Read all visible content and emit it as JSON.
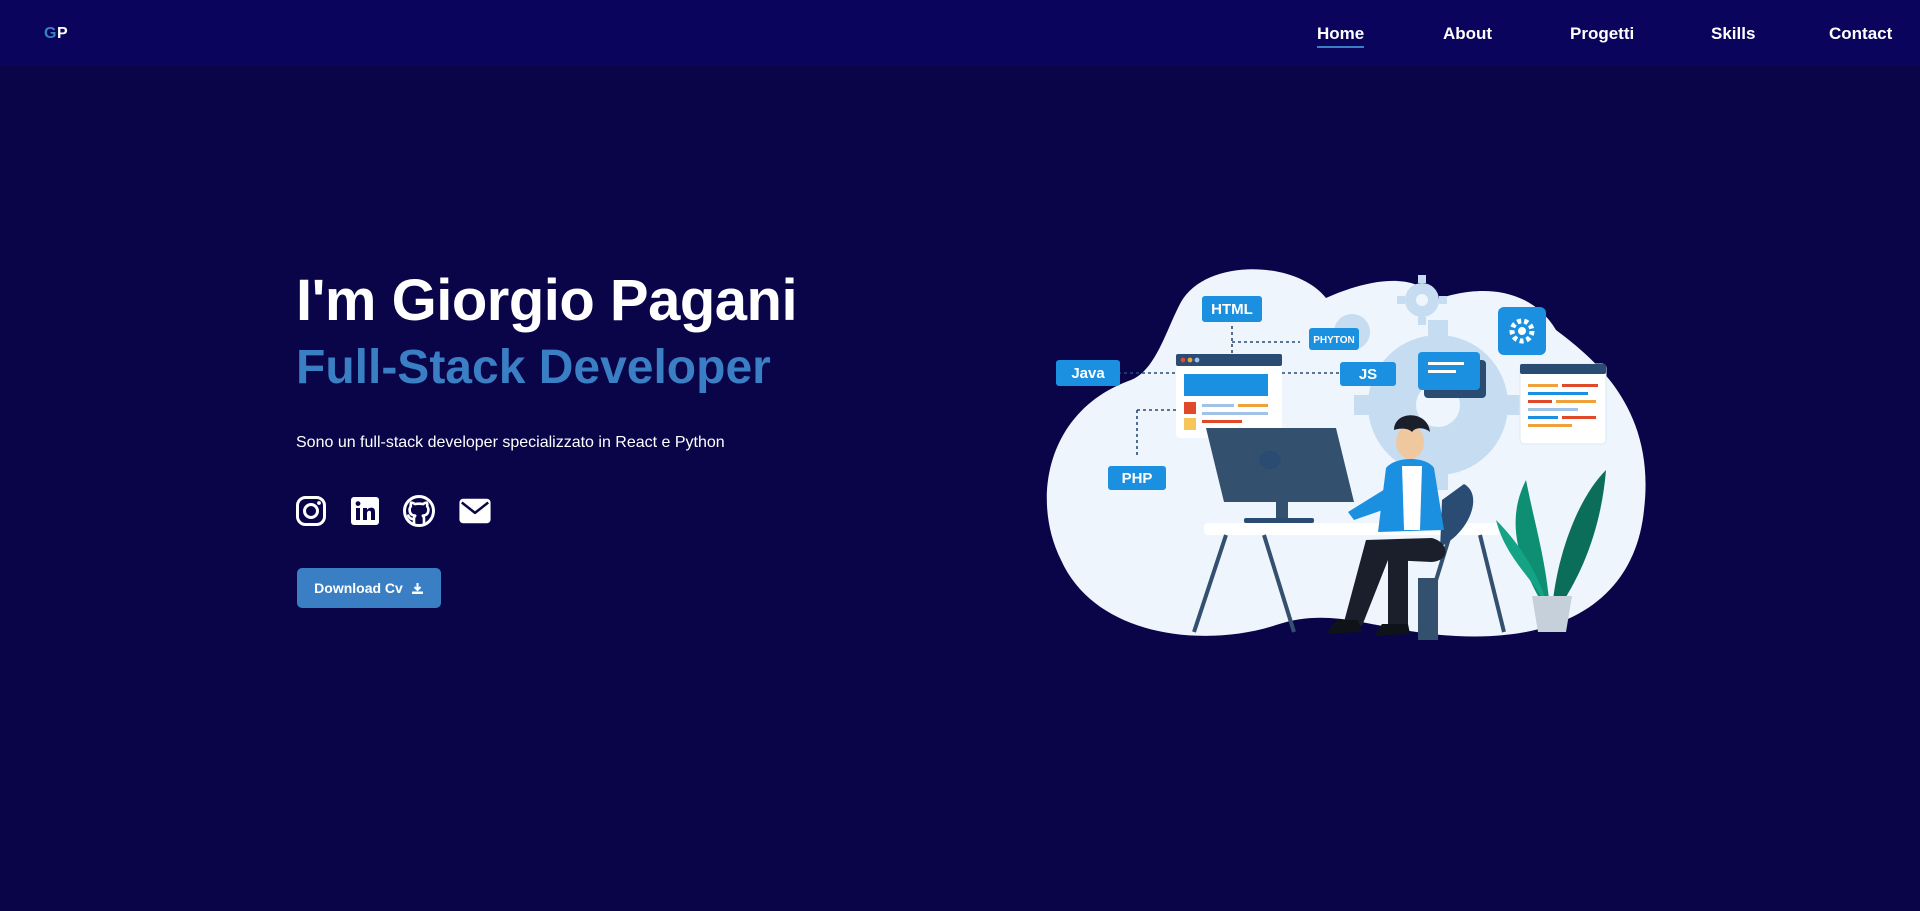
{
  "nav": {
    "logo_first": "G",
    "logo_second": "P",
    "links": [
      {
        "label": "Home"
      },
      {
        "label": "About"
      },
      {
        "label": "Progetti"
      },
      {
        "label": "Skills"
      },
      {
        "label": "Contact"
      }
    ],
    "active_index": 0
  },
  "hero": {
    "title": "I'm Giorgio Pagani",
    "subtitle": "Full-Stack Developer",
    "description": "Sono un full-stack developer specializzato in React e Python",
    "download_label": "Download Cv"
  },
  "socials": [
    {
      "icon": "instagram-icon"
    },
    {
      "icon": "linkedin-icon"
    },
    {
      "icon": "github-icon"
    },
    {
      "icon": "mail-icon"
    }
  ],
  "illustration": {
    "tags": [
      "HTML",
      "PHYTON",
      "Java",
      "JS",
      "PHP"
    ]
  },
  "colors": {
    "background": "#0a0449",
    "navbar": "#0a045c",
    "accent": "#3a7fc4",
    "text": "#ffffff",
    "tag": "#1b8fe0"
  }
}
